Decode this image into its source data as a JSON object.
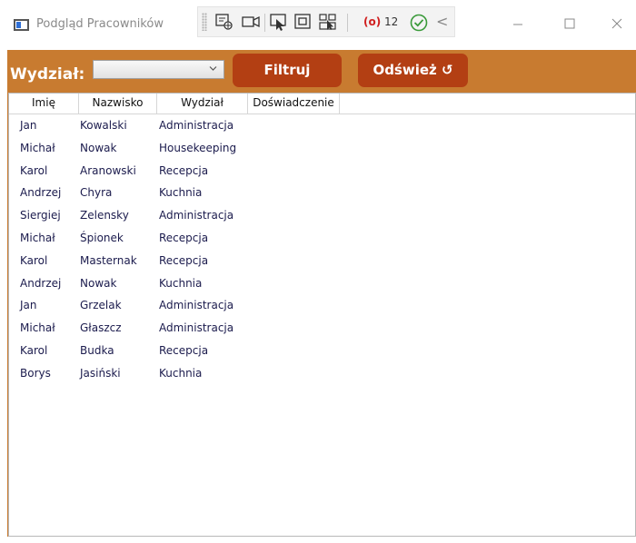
{
  "window": {
    "title": "Podgląd Pracowników",
    "debug_counter_label": "12"
  },
  "toolbar": {
    "department_label": "Wydział:",
    "department_value": "",
    "filter_label": "Filtruj",
    "refresh_label": "Odśwież ↺"
  },
  "grid": {
    "columns": [
      "Imię",
      "Nazwisko",
      "Wydział",
      "Doświadczenie"
    ],
    "rows": [
      {
        "first": "Jan",
        "last": "Kowalski",
        "dept": "Administracja",
        "exp": ""
      },
      {
        "first": "Michał",
        "last": "Nowak",
        "dept": "Housekeeping",
        "exp": ""
      },
      {
        "first": "Karol",
        "last": "Aranowski",
        "dept": "Recepcja",
        "exp": ""
      },
      {
        "first": "Andrzej",
        "last": "Chyra",
        "dept": "Kuchnia",
        "exp": ""
      },
      {
        "first": "Siergiej",
        "last": "Zelensky",
        "dept": "Administracja",
        "exp": ""
      },
      {
        "first": "Michał",
        "last": "Śpionek",
        "dept": "Recepcja",
        "exp": ""
      },
      {
        "first": "Karol",
        "last": "Masternak",
        "dept": "Recepcja",
        "exp": ""
      },
      {
        "first": "Andrzej",
        "last": "Nowak",
        "dept": "Kuchnia",
        "exp": ""
      },
      {
        "first": "Jan",
        "last": "Grzelak",
        "dept": "Administracja",
        "exp": ""
      },
      {
        "first": "Michał",
        "last": "Głaszcz",
        "dept": "Administracja",
        "exp": ""
      },
      {
        "first": "Karol",
        "last": "Budka",
        "dept": "Recepcja",
        "exp": ""
      },
      {
        "first": "Borys",
        "last": "Jasiński",
        "dept": "Kuchnia",
        "exp": ""
      }
    ]
  },
  "colors": {
    "frame": "#c87b30",
    "button": "#b33f13",
    "button_text": "#ffffff",
    "cell_text": "#1b1b4d"
  },
  "icons": [
    "app-window-icon",
    "select-element-icon",
    "record-icon",
    "pointer-select-icon",
    "layout-adorner-icon",
    "track-focus-icon",
    "binding-failures-icon",
    "check-circle-icon",
    "collapse-chevron-icon",
    "minimize-icon",
    "maximize-icon",
    "close-icon",
    "chevron-down-icon",
    "refresh-icon"
  ]
}
